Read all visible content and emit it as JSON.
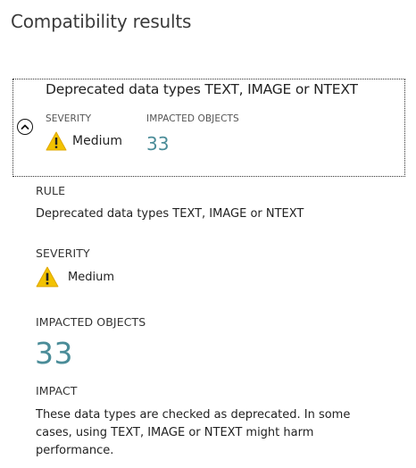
{
  "page": {
    "title": "Compatibility results"
  },
  "card": {
    "title": "Deprecated data types TEXT, IMAGE or NTEXT",
    "severity_label": "SEVERITY",
    "severity_value": "Medium",
    "impacted_label": "IMPACTED OBJECTS",
    "impacted_count": "33",
    "collapse_icon": "chevron-up-icon"
  },
  "details": {
    "rule_label": "RULE",
    "rule_value": "Deprecated data types TEXT, IMAGE or NTEXT",
    "severity_label": "SEVERITY",
    "severity_value": "Medium",
    "severity_icon": "warning-icon",
    "impacted_label": "IMPACTED OBJECTS",
    "impacted_count": "33",
    "impact_label": "IMPACT",
    "impact_text": "These data types are checked as deprecated. In some cases, using TEXT, IMAGE or NTEXT might harm performance."
  },
  "colors": {
    "warning": "#f2c200",
    "count": "#4a8c98"
  }
}
